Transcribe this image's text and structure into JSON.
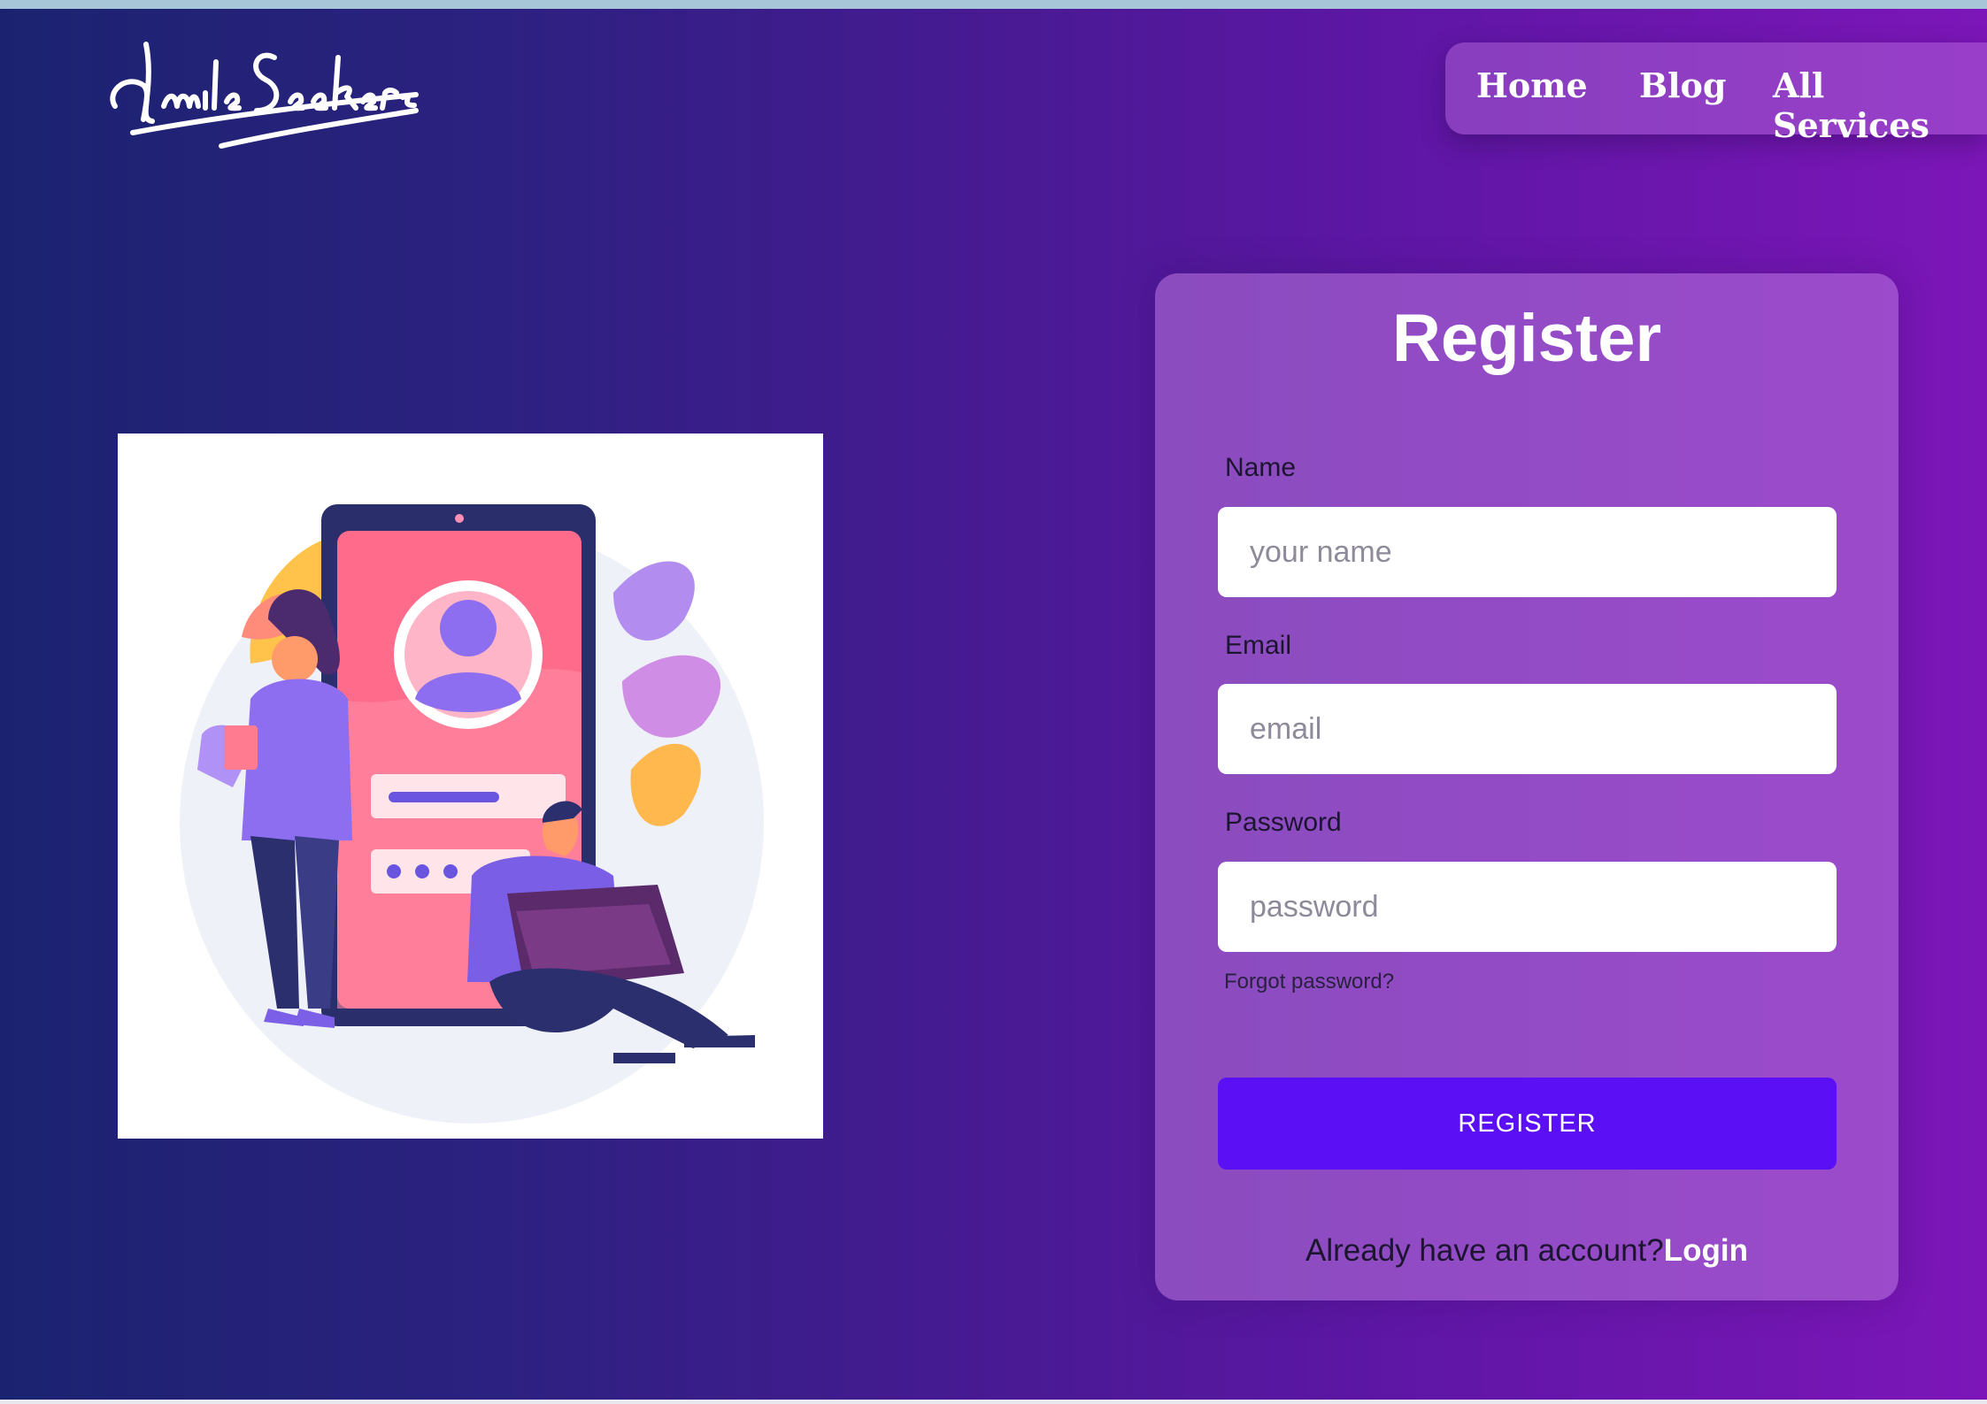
{
  "brand": {
    "logo_text": "SmileSeekers"
  },
  "nav": {
    "items": [
      {
        "label": "Home"
      },
      {
        "label": "Blog"
      },
      {
        "label": "All Services"
      }
    ]
  },
  "illustration": {
    "icon": "login-illustration"
  },
  "form": {
    "title": "Register",
    "name_label": "Name",
    "name_placeholder": "your name",
    "email_label": "Email",
    "email_placeholder": "email",
    "password_label": "Password",
    "password_placeholder": "password",
    "forgot_label": "Forgot password?",
    "submit_label": "REGISTER",
    "footer_text": "Already have an account?",
    "login_label": "Login"
  },
  "colors": {
    "button": "#5b0ff5",
    "background_left": "#1b2370",
    "background_right": "#7c16b8"
  }
}
